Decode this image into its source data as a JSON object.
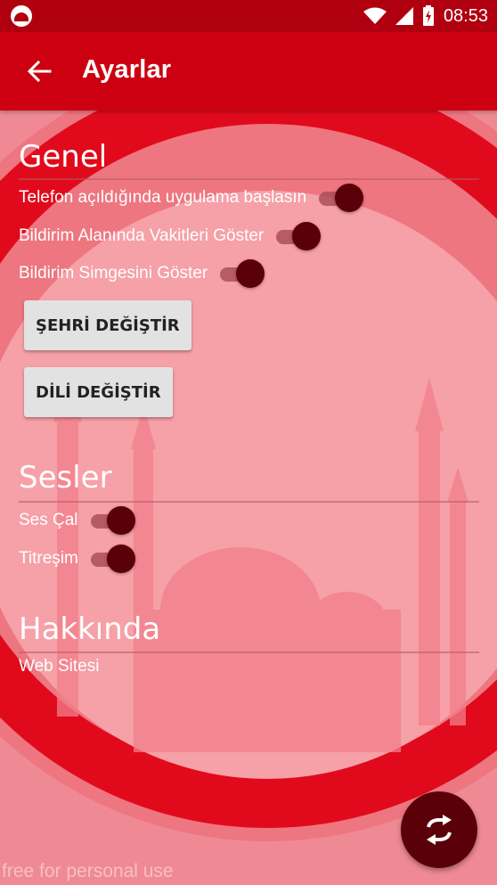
{
  "status_bar": {
    "time": "08:53",
    "icons": [
      "app-logo-icon",
      "wifi-icon",
      "cell-signal-icon",
      "battery-charging-icon"
    ]
  },
  "toolbar": {
    "title": "Ayarlar",
    "back_icon": "arrow-left-icon"
  },
  "sections": {
    "general": {
      "title": "Genel",
      "settings": [
        {
          "label": "Telefon açıldığında uygulama başlasın",
          "on": true
        },
        {
          "label": "Bildirim Alanında Vakitleri Göster",
          "on": true
        },
        {
          "label": "Bildirim Simgesini Göster",
          "on": true
        }
      ],
      "buttons": [
        {
          "label": "ŞEHRİ DEĞİŞTİR"
        },
        {
          "label": "DİLİ DEĞİŞTİR"
        }
      ]
    },
    "sounds": {
      "title": "Sesler",
      "settings": [
        {
          "label": "Ses Çal",
          "on": true
        },
        {
          "label": "Titreşim",
          "on": true
        }
      ]
    },
    "about": {
      "title": "Hakkında",
      "link": "Web Sitesi"
    }
  },
  "fab": {
    "icon": "sync-icon"
  },
  "watermark": "free for personal use",
  "colors": {
    "statusbar": "#b00010",
    "toolbar": "#cc0010",
    "background": "#ef8a94",
    "switch_thumb": "#5a0008",
    "button": "#e2e2e2"
  }
}
